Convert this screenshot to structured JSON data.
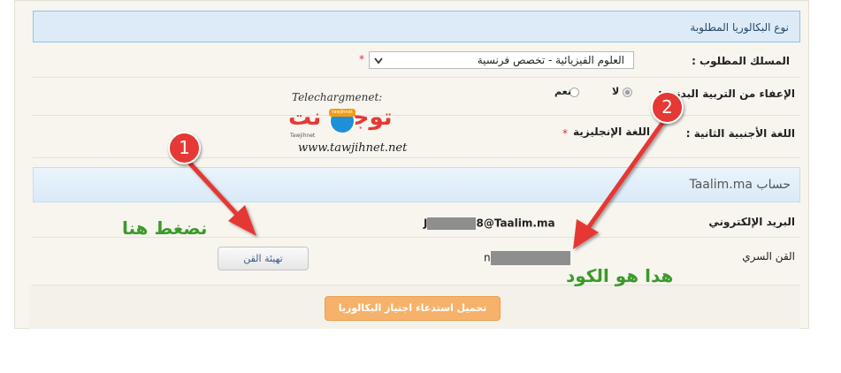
{
  "section_bac": {
    "title": "نوع البكالوريا المطلوبة",
    "rows": [
      {
        "label": "المسلك المطلوب :",
        "select_value": "العلوم الفيزيائية - تخصص فرنسية",
        "required": "*"
      },
      {
        "label": "الإعفاء من التربية البدنية :",
        "options": [
          "لا",
          "نعم"
        ],
        "selected": "لا"
      },
      {
        "label": "اللغة الأجنبية الثانية :",
        "value": "اللغة الإنجليزية",
        "required": "*"
      }
    ]
  },
  "section_account": {
    "title": "حساب Taalim.ma",
    "email_label": "البريد الإلكتروني",
    "email_value_start": "J",
    "email_value_end": "8@Taalim.ma",
    "password_label": "القن السري",
    "password_value_start": "n",
    "reset_button": "تهيئة القن"
  },
  "download_button": "تحميل استدعاء اجتياز البكالوريا",
  "watermark": {
    "top_text": "Telechargmenet:",
    "logo_text": "توجيه نت",
    "logo_badge": "tawjihnet",
    "logo_small": "Tawjihnet",
    "url": "www.tawjihnet.net"
  },
  "annotations": {
    "marker1": "1",
    "marker2": "2",
    "click_here": "نضغط هنا",
    "this_is_code": "هدا هو الكود"
  },
  "colors": {
    "header_bg": "#dcebf7",
    "download_button": "#f6b26b",
    "arrow_red": "#e53935",
    "annotation_green": "#3a9a2a"
  }
}
